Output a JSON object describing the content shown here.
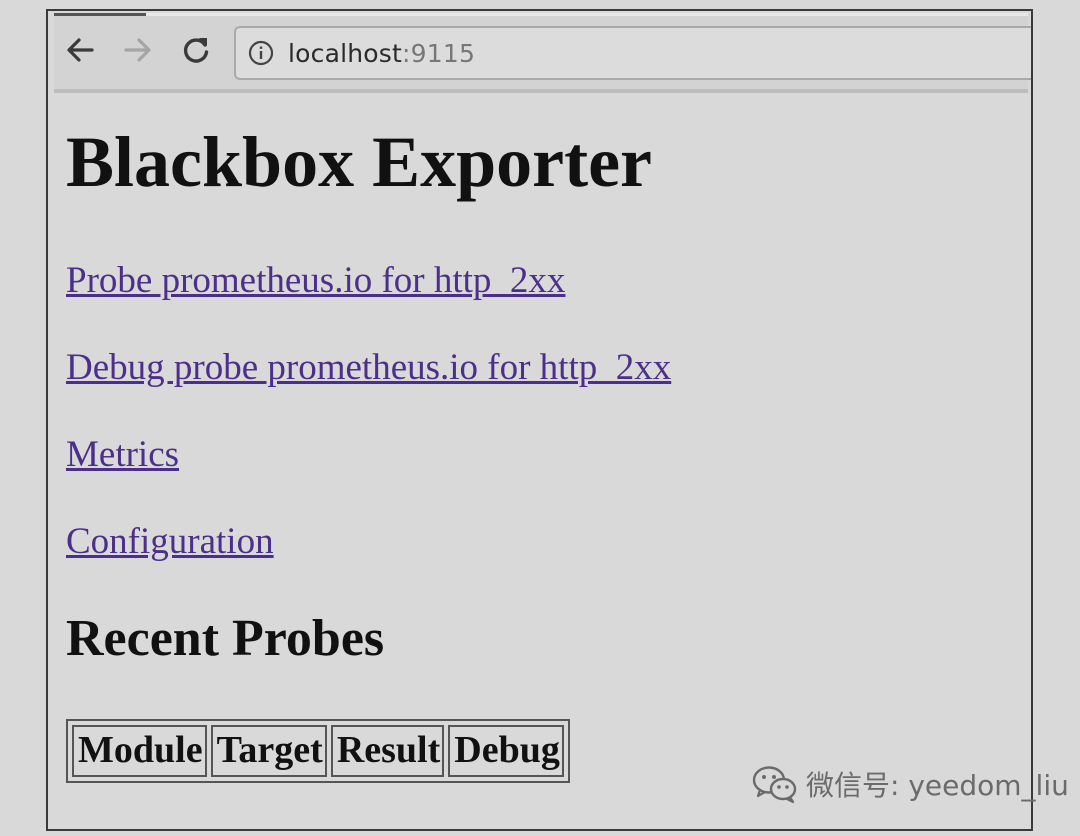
{
  "browser": {
    "url_host": "localhost",
    "url_port": ":9115"
  },
  "page": {
    "title": "Blackbox Exporter",
    "links": [
      "Probe prometheus.io for http_2xx",
      "Debug probe prometheus.io for http_2xx",
      "Metrics",
      "Configuration"
    ],
    "recent_heading": "Recent Probes",
    "table_headers": [
      "Module",
      "Target",
      "Result",
      "Debug"
    ]
  },
  "watermark": {
    "text": "微信号: yeedom_liu",
    "icon": "wechat-icon"
  },
  "colors": {
    "link": "#4b2f8a",
    "background": "#d9d9d9"
  }
}
